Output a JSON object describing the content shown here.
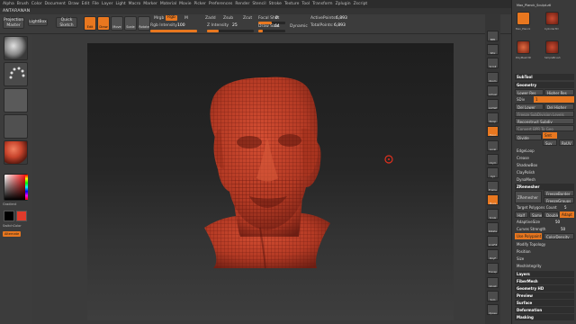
{
  "menu": {
    "items": [
      "Alpha",
      "Brush",
      "Color",
      "Document",
      "Draw",
      "Edit",
      "File",
      "Layer",
      "Light",
      "Macro",
      "Marker",
      "Material",
      "Movie",
      "Picker",
      "Preferences",
      "Render",
      "Stencil",
      "Stroke",
      "Texture",
      "Tool",
      "Transform",
      "Zplugin",
      "Zscript"
    ]
  },
  "app_title": "ANTARANAN",
  "toolbar": {
    "projection_master": "Projection Master",
    "lightbox": "LightBox",
    "quick_sketch": "Quick Sketch",
    "mode_edit": "Edit",
    "mode_draw": "Draw",
    "mode_move": "Move",
    "mode_scale": "Scale",
    "mode_rotate": "Rotate",
    "mrgb": "Mrgb",
    "rgb": "Rgb",
    "m": "M",
    "zadd": "Zadd",
    "zsub": "Zsub",
    "zcut": "Zcut",
    "rgb_intensity_label": "Rgb Intensity",
    "rgb_intensity": "100",
    "z_intensity_label": "Z Intensity",
    "z_intensity": "25",
    "focal_shift_label": "Focal Shift",
    "focal_shift": "0",
    "draw_size_label": "Draw Size",
    "draw_size": "64",
    "dynamic": "Dynamic",
    "active_points_label": "ActivePoints:",
    "active_points": "6,893",
    "total_points_label": "TotalPoints:",
    "total_points": "6,893"
  },
  "left_shelf": {
    "gradient_label": "Gradient",
    "switch_color_label": "SwitchColor",
    "alternate_label": "Alternate"
  },
  "right_icons": [
    "BPR",
    "SPix",
    "Scroll",
    "Zoom",
    "Actual",
    "AAHalf",
    "Persp",
    "Floor",
    "Local",
    "LSym",
    "Xyz",
    "Frame",
    "Move",
    "Scale",
    "Rotate",
    "LineFill",
    "PolyF",
    "Transp",
    "Ghost",
    "Solo",
    "Xpose"
  ],
  "right_panel": {
    "tool_name": "Max_Planck_Sculpt.ztl",
    "thumb_labels": [
      "Max_Planck",
      "Cylinder3D",
      "PolyMesh3D",
      "SimpleBrush"
    ],
    "subtool": "SubTool",
    "geometry": "Geometry",
    "lower_res": "Lower Res",
    "higher_res": "Higher Res",
    "sdiv_label": "SDiv",
    "sdiv": "1",
    "del_lower": "Del Lower",
    "del_higher": "Del Higher",
    "freeze_subdivision": "Freeze SubDivision Levels",
    "reconstruct_subdiv": "Reconstruct Subdiv",
    "convert_bpr": "Convert BPR To Geo",
    "divide": "Divide",
    "smt": "Smt",
    "suv": "Suv",
    "rsmt": "ReUV",
    "edgeloop": "EdgeLoop",
    "crease": "Crease",
    "shadowbox": "ShadowBox",
    "claypolish": "ClayPolish",
    "dynamesh": "DynaMesh",
    "zremesher": "ZRemesher",
    "freeze_border": "FreezeBorder",
    "freeze_groups": "FreezeGroups",
    "target_poly_label": "Target Polygons Count",
    "target_poly": "5",
    "half": "Half",
    "same": "Same",
    "double": "Double",
    "adapt": "Adapt",
    "adaptive_size_label": "AdaptiveSize",
    "adaptive_size": "50",
    "curves_strength_label": "Curves Strength",
    "curves_strength": "50",
    "use_polypaint": "Use Polypaint",
    "color_density": "ColorDensity",
    "modify_topology": "Modify Topology",
    "position": "Position",
    "size": "Size",
    "mesh_integrity": "MeshIntegrity",
    "layers": "Layers",
    "fibermesh": "FiberMesh",
    "geometry_hd": "Geometry HD",
    "preview": "Preview",
    "surface": "Surface",
    "deformation": "Deformation",
    "masking": "Masking"
  },
  "colors": {
    "accent": "#e8771f",
    "mesh": "#c9442c",
    "wire": "#7a1d12",
    "panel_bg": "#3a3a3a",
    "canvas_top": "#1e1e1e"
  }
}
